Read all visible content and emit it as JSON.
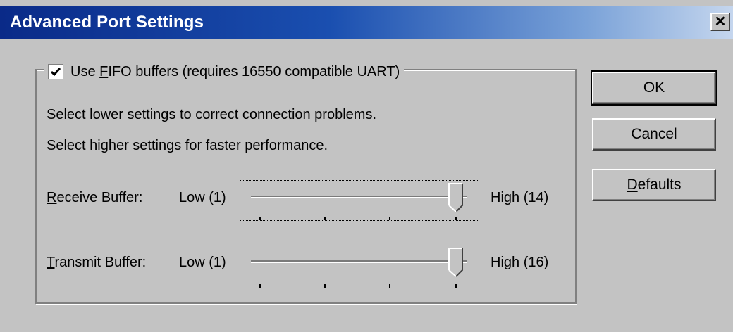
{
  "window": {
    "title": "Advanced Port Settings",
    "close_glyph": "✕"
  },
  "group": {
    "checkbox_checked": true,
    "checkbox_label_pre": "Use ",
    "checkbox_label_accel": "F",
    "checkbox_label_post": "IFO buffers (requires 16550 compatible UART)"
  },
  "info": {
    "line1": "Select lower settings to correct connection problems.",
    "line2": "Select higher settings for faster performance."
  },
  "receive": {
    "label_accel": "R",
    "label_rest": "eceive Buffer:",
    "low_label": "Low (1)",
    "high_label": "High (14)",
    "value_fraction": 1.0
  },
  "transmit": {
    "label_accel": "T",
    "label_rest": "ransmit Buffer:",
    "low_label": "Low (1)",
    "high_label": "High (16)",
    "value_fraction": 1.0
  },
  "buttons": {
    "ok": "OK",
    "cancel": "Cancel",
    "defaults_accel": "D",
    "defaults_rest": "efaults"
  },
  "colors": {
    "face": "#c3c3c3",
    "title_start": "#0a2a88",
    "title_end": "#c5d6ee"
  },
  "icons": {
    "checkmark": "check-icon",
    "close": "close-icon"
  }
}
